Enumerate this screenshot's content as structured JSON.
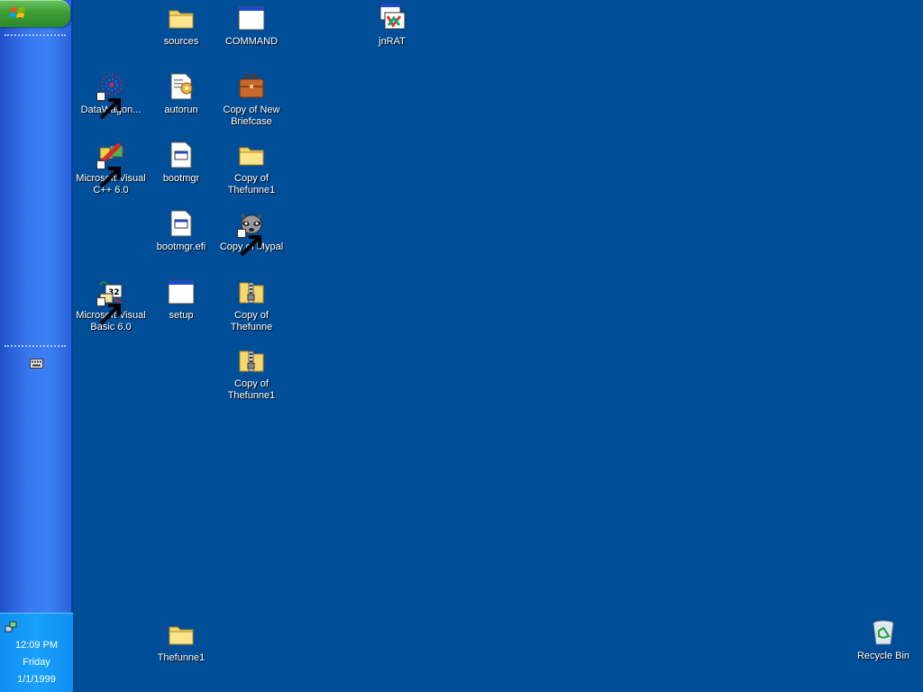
{
  "taskbar": {
    "clock": {
      "time": "12:09 PM",
      "day": "Friday",
      "date": "1/1/1999"
    }
  },
  "desktop": {
    "icons": [
      {
        "label": "sources",
        "icon": "folder-icon"
      },
      {
        "label": "COMMAND",
        "icon": "window-app-icon"
      },
      {
        "label": "jnRAT",
        "icon": "java-app-icon"
      },
      {
        "label": "DataWagon...",
        "icon": "fireworks-icon"
      },
      {
        "label": "autorun",
        "icon": "settings-file-icon"
      },
      {
        "label": "Copy of New Briefcase",
        "icon": "briefcase-icon"
      },
      {
        "label": "Microsoft Visual C++ 6.0",
        "icon": "visual-cpp-icon"
      },
      {
        "label": "bootmgr",
        "icon": "system-file-icon"
      },
      {
        "label": "Copy of Thefunne1",
        "icon": "folder-icon"
      },
      {
        "label": "bootmgr.efi",
        "icon": "system-file-icon"
      },
      {
        "label": "Copy of Mypal",
        "icon": "raccoon-icon"
      },
      {
        "label": "Microsoft Visual Basic 6.0",
        "icon": "visual-basic-icon"
      },
      {
        "label": "setup",
        "icon": "window-app-icon"
      },
      {
        "label": "Copy of Thefunne",
        "icon": "zip-folder-icon"
      },
      {
        "label": "Copy of Thefunne1",
        "icon": "zip-folder-icon"
      },
      {
        "label": "Thefunne1",
        "icon": "folder-icon"
      },
      {
        "label": "Recycle Bin",
        "icon": "recycle-bin-icon"
      }
    ]
  },
  "colors": {
    "desktop_background": "#004e98",
    "taskbar_blue": "#3c80f4",
    "start_green": "#3d9e34",
    "clock_tray": "#19a0fb"
  }
}
